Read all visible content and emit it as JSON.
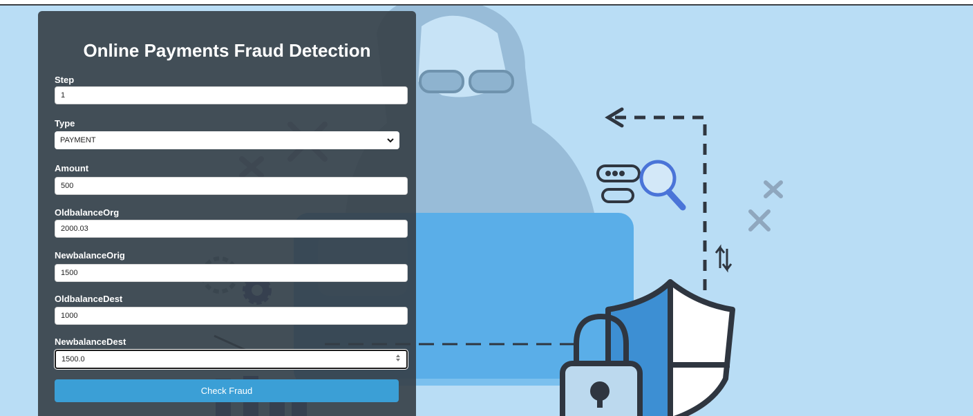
{
  "form": {
    "title": "Online Payments Fraud Detection",
    "fields": [
      {
        "label": "Step",
        "value": "1"
      },
      {
        "label": "Type",
        "value": "PAYMENT"
      },
      {
        "label": "Amount",
        "value": "500"
      },
      {
        "label": "OldbalanceOrg",
        "value": "2000.03"
      },
      {
        "label": "NewbalanceOrig",
        "value": "1500"
      },
      {
        "label": "OldbalanceDest",
        "value": "1000"
      },
      {
        "label": "NewbalanceDest",
        "value": "1500.0"
      }
    ],
    "submit_label": "Check Fraud"
  },
  "colors": {
    "background": "#b9ddf5",
    "panel": "#353e46",
    "button": "#3b9fd6",
    "laptop": "#5aaee8",
    "shield_blue": "#3d8fd3",
    "outline": "#2f3640"
  },
  "icons": [
    "hacker-figure",
    "laptop-icon",
    "gear-icon",
    "shield-icon",
    "padlock-icon",
    "magnifier-icon",
    "password-field-icon",
    "arrow-left-icon",
    "transfer-arrows-icon",
    "cross-icon",
    "bar-chart-icon"
  ]
}
